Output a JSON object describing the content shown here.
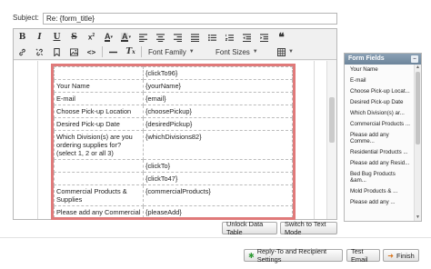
{
  "subject": {
    "label": "Subject:",
    "value": "Re: {form_title}"
  },
  "toolbar": {
    "row1": [
      "bold",
      "italic",
      "underline",
      "strikethrough",
      "superscript",
      "font-color",
      "bg-color",
      "align-left",
      "align-center",
      "align-right",
      "align-justify",
      "bullet-list",
      "numbered-list",
      "outdent",
      "indent",
      "blockquote"
    ],
    "row2": [
      "link",
      "unlink",
      "anchor",
      "image",
      "source",
      "horizontal-rule",
      "remove-format"
    ],
    "font_family": "Font Family",
    "font_sizes": "Font Sizes"
  },
  "data_table": {
    "rows": [
      [
        "",
        "{clickTo96}"
      ],
      [
        "Your Name",
        "{yourName}"
      ],
      [
        "E-mail",
        "{email}"
      ],
      [
        "Choose Pick-up Location",
        "{choosePickup}"
      ],
      [
        "Desired Pick-up Date",
        "{desiredPickup}"
      ],
      [
        "Which Division(s) are you ordering supplies for? (select 1, 2 or all 3)",
        "{whichDivisions82}"
      ],
      [
        "",
        "{clickTo}"
      ],
      [
        "",
        "{clickTo47}"
      ],
      [
        "Commercial Products & Supplies",
        "{commercialProducts}"
      ],
      [
        "Please add any Commercial products in the space below",
        "{pleaseAdd}"
      ]
    ]
  },
  "form_fields": {
    "title": "Form Fields",
    "items": [
      "Your Name",
      "E-mail",
      "Choose Pick-up Locat...",
      "Desired Pick-up Date",
      "Which Division(s) ar...",
      "Commercial Products ...",
      "Please add any Comme...",
      "Residential Products ...",
      "Please add any Resid...",
      "Bed Bug Products &am...",
      "Mold Products & ...",
      "Please add any ..."
    ]
  },
  "buttons": {
    "unlock": "Unlock Data Table",
    "switch": "Switch to Text Mode",
    "reply": "Reply-To and Recipient Settings",
    "test": "Test Email",
    "finish": "Finish"
  }
}
